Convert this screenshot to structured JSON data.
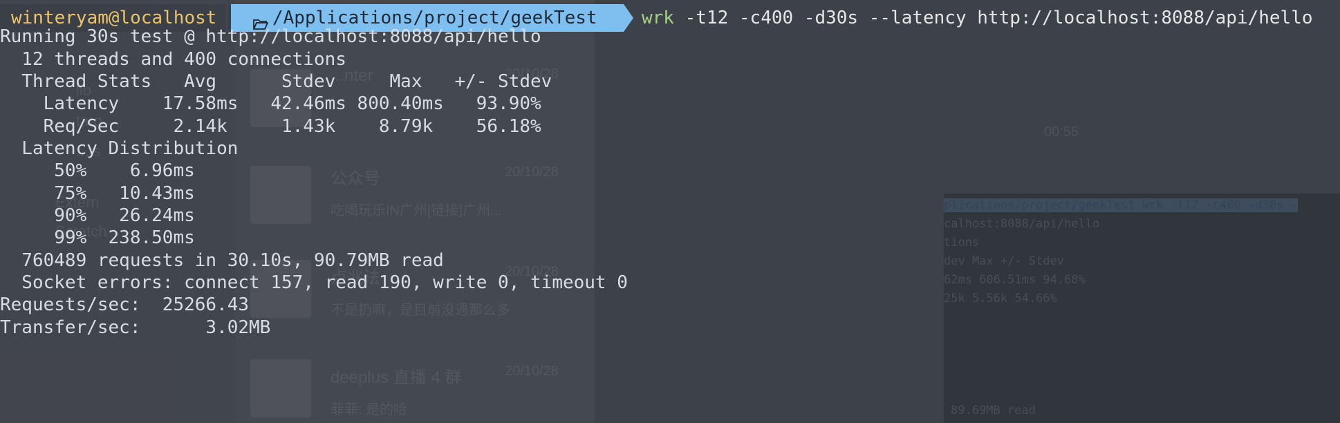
{
  "prompt": {
    "user_host": "winteryam@localhost",
    "path": "/Applications/project/geekTest",
    "command_exe": "wrk",
    "command_args": " -t12 -c400 -d30s --latency http://localhost:8088/api/hello"
  },
  "output": {
    "running": "Running 30s test @ http://localhost:8088/api/hello",
    "threads": "  12 threads and 400 connections",
    "stats_header": "  Thread Stats   Avg      Stdev     Max   +/- Stdev",
    "latency_row": "    Latency    17.58ms   42.46ms 800.40ms   93.90%",
    "reqsec_row": "    Req/Sec     2.14k     1.43k    8.79k    56.18%",
    "latency_dist": "  Latency Distribution",
    "p50": "     50%    6.96ms",
    "p75": "     75%   10.43ms",
    "p90": "     90%   26.24ms",
    "p99": "     99%  238.50ms",
    "requests": "  760489 requests in 30.10s, 90.79MB read",
    "socket_errors": "  Socket errors: connect 157, read 190, write 0, timeout 0",
    "requests_sec": "Requests/sec:  25266.43",
    "transfer_sec": "Transfer/sec:      3.02MB"
  },
  "background": {
    "chat_items": [
      {
        "name": "...nter",
        "date": "20/10/28",
        "preview": ""
      },
      {
        "name": "公众号",
        "date": "20/10/28",
        "preview": "吃喝玩乐IN广州[链接]广州..."
      },
      {
        "name": "卢兆法",
        "date": "20/10/28",
        "preview": "不是扔嘛，是目前没遇那么多"
      },
      {
        "name": "deeplus 直播 4 群",
        "date": "20/10/28",
        "preview": "菲菲: 是的哈"
      }
    ],
    "time_label": "00:55",
    "sidebar_items": [
      "lib",
      "targ",
      "...ts",
      "Extern",
      "Scratch"
    ],
    "ghost_terminal_lines": [
      "plications/project/geekTest  wrk -t12 -c400 -d30s -",
      "calhost:8088/api/hello",
      "tions",
      "dev     Max   +/- Stdev",
      "62ms 606.51ms   94.68%",
      "25k    5.56k    54.66%",
      "89.69MB read"
    ]
  },
  "colors": {
    "background": "#3d414a",
    "text": "#d9dde3",
    "user_host": "#e9c46a",
    "path_bg": "#7fbff0",
    "command_exe": "#a6d189"
  }
}
